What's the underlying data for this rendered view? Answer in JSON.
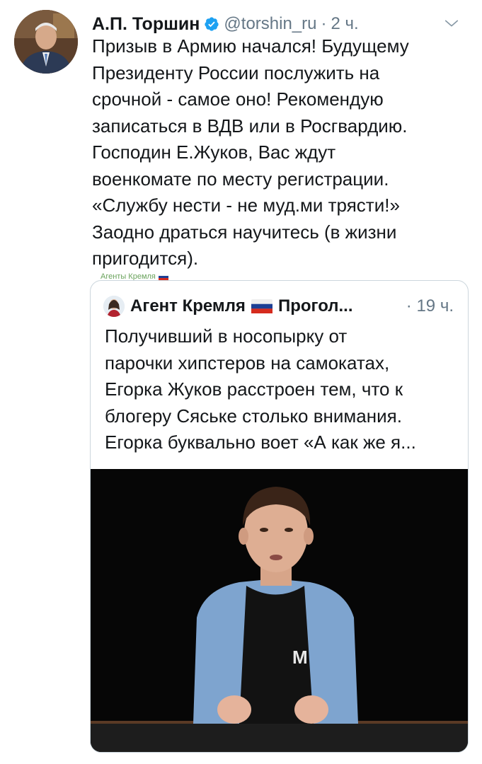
{
  "tweet": {
    "author_name": "А.П. Торшин",
    "handle": "@torshin_ru",
    "separator": "·",
    "time": "2 ч.",
    "text_lines": [
      "Призыв в Армию начался! Будущему",
      "Президенту России послужить на",
      "срочной - самое оно! Рекомендую",
      "записаться в ВДВ или в Росгвардию.",
      "Господин Е.Жуков, Вас ждут",
      "военкомате по месту регистрации.",
      "«Службу  нести - не муд.ми трясти!»",
      "Заодно драться научитесь (в жизни",
      "пригодится)."
    ]
  },
  "watermark": {
    "text": "Агенты Кремля"
  },
  "quote": {
    "author_name": "Агент Кремля",
    "author_name_suffix": "Прогол...",
    "separator": "·",
    "time": "19 ч.",
    "text_lines": [
      "Получивший в носопырку от",
      "парочки хипстеров на самокатах,",
      "Егорка Жуков расстроен тем, что к",
      "блогеру Сяське столько внимания.",
      "Егорка буквально воет «А как же я..."
    ]
  },
  "colors": {
    "verified_blue": "#1da1f2",
    "secondary_text": "#657786",
    "card_border": "#ccd6dd"
  },
  "icons": {
    "verified": "verified-badge-icon",
    "chevron": "chevron-down-icon",
    "flag": "russian-flag-icon"
  }
}
